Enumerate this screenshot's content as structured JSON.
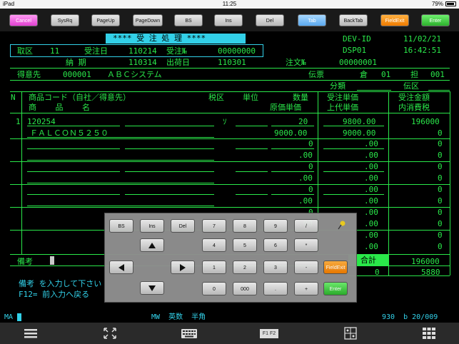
{
  "status": {
    "device": "iPad",
    "time": "11:25",
    "battery": "79%"
  },
  "toolbar": [
    {
      "label": "Cancel",
      "color": "#f050e0"
    },
    {
      "label": "SysRq"
    },
    {
      "label": "PageUp"
    },
    {
      "label": "PageDown"
    },
    {
      "label": "BS"
    },
    {
      "label": "Ins"
    },
    {
      "label": "Del"
    },
    {
      "label": "Tab",
      "color": "#6fb8f0"
    },
    {
      "label": "BackTab"
    },
    {
      "label": "FieldExit",
      "color": "#f08a10"
    },
    {
      "label": "Enter",
      "color": "#3cc43c"
    }
  ],
  "screen": {
    "title": "**** 受 注 処 理 ****",
    "devid": "DEV-ID",
    "date": "11/02/21",
    "dsp": "DSP01",
    "clock": "16:42:51",
    "row1": {
      "a": "取区",
      "b": "11",
      "c": "受注日",
      "d": "110214",
      "e": "受注№",
      "f": "00000000"
    },
    "row2": {
      "a": "納 期",
      "b": "110314",
      "c": "出荷日",
      "d": "110301",
      "e": "注文№",
      "f": "00000001"
    },
    "row3": {
      "a": "得意先",
      "b": "000001",
      "c": "ＡＢＣシステム",
      "d": "伝票",
      "e": "倉",
      "f": "01",
      "g": "担",
      "h": "001"
    },
    "row4": {
      "a": "分類",
      "b": "伝区"
    },
    "hdr1": {
      "n": "N",
      "a": "商品コード（自社／得意先）",
      "b": "税区",
      "c": "単位",
      "d": "数量",
      "e": "受注単価",
      "f": "受注金額"
    },
    "hdr2": {
      "a": "商    品    名",
      "d": "原価単価",
      "e": "上代単価",
      "f": "内消費税"
    },
    "line1": {
      "n": "1",
      "code": "120254",
      "tax": "ｿ",
      "qty": "20",
      "price": "9800.00",
      "amount": "196000"
    },
    "line1b": {
      "name": "ＦＡＬＣＯＮ５２５０",
      "cost": "9000.00",
      "retail": "9000.00",
      "tax": "0"
    },
    "blank_qty": "0",
    "blank_dec": ".00",
    "remarks_label": "備考",
    "total_label": "合計",
    "total": "196000",
    "total_tax_left": "0",
    "total_tax": "5880",
    "msg1": "備考 を入力して下さい",
    "msg2": "F12= 前入力へ戻る",
    "sline_left": "MA",
    "sline_mid": "MW  英数  半角",
    "sline_right": "930  b 20/009"
  },
  "keypad": {
    "bs": "BS",
    "ins": "Ins",
    "del": "Del",
    "n7": "7",
    "n8": "8",
    "n9": "9",
    "slash": "/",
    "n4": "4",
    "n5": "5",
    "n6": "6",
    "star": "*",
    "n1": "1",
    "n2": "2",
    "n3": "3",
    "minus": "-",
    "n0": "0",
    "n000": "000",
    "dot": ".",
    "plus": "+",
    "fieldexit": "FieldExit",
    "enter": "Enter"
  },
  "bottomnav": {
    "fkeys": "F1 F2"
  }
}
